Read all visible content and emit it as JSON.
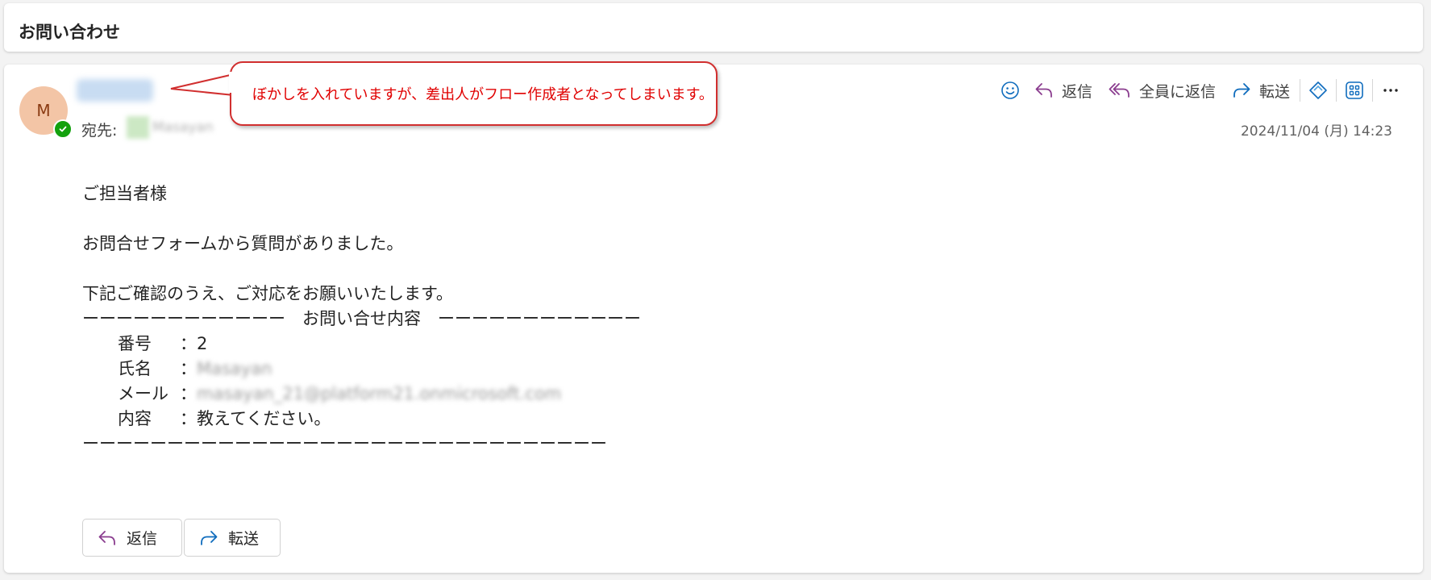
{
  "subject": "お問い合わせ",
  "message": {
    "avatar_initial": "M",
    "to_label": "宛先:",
    "to_blurred": "Masayan",
    "date": "2024/11/04 (月) 14:23",
    "callout": "ぼかしを入れていますが、差出人がフロー作成者となってしまいます。"
  },
  "toolbar": {
    "reply": "返信",
    "reply_all": "全員に返信",
    "forward": "転送"
  },
  "body": {
    "greeting": "ご担当者様",
    "line1": "お問合せフォームから質問がありました。",
    "line2": "下記ご確認のうえ、ご対応をお願いいたします。",
    "divider_top": "ーーーーーーーーーーーー　お問い合せ内容　ーーーーーーーーーーーー",
    "fields": [
      {
        "label": "番号",
        "sep": "：",
        "value": "2"
      },
      {
        "label": "氏名",
        "sep": "：",
        "value": "Masayan"
      },
      {
        "label": "メール",
        "sep": "：",
        "value": "masayan_21@platform21.onmicrosoft.com"
      },
      {
        "label": "内容",
        "sep": "：",
        "value": "教えてください。"
      }
    ],
    "divider_bottom": "ーーーーーーーーーーーーーーーーーーーーーーーーーーーーーーー"
  },
  "footer": {
    "reply": "返信",
    "forward": "転送"
  },
  "colors": {
    "reply_icon": "#8a3c8e",
    "forward_icon": "#0f6cbd",
    "callout_text": "#e00000"
  }
}
